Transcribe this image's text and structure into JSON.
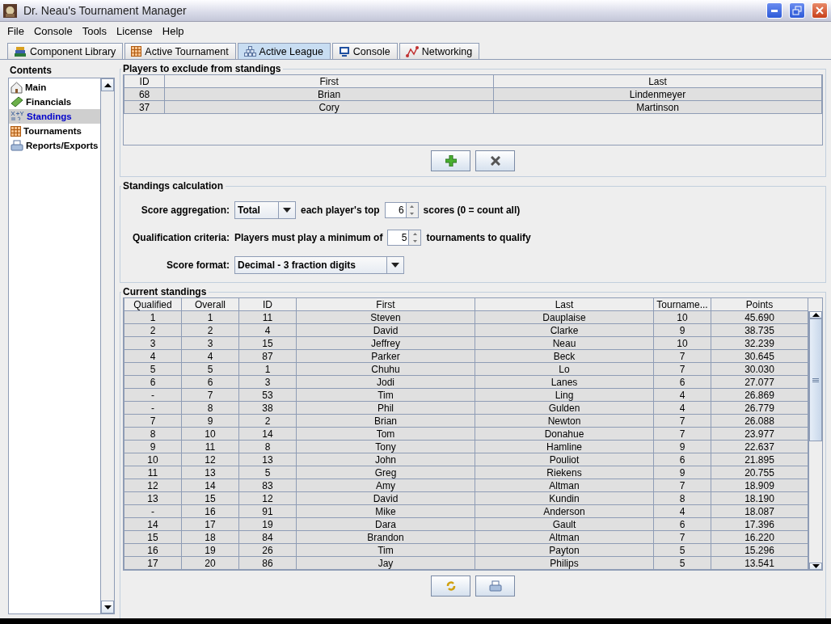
{
  "window": {
    "title": "Dr. Neau's Tournament Manager"
  },
  "menu": [
    "File",
    "Console",
    "Tools",
    "License",
    "Help"
  ],
  "tabs": [
    {
      "label": "Component Library",
      "selected": false
    },
    {
      "label": "Active Tournament",
      "selected": false
    },
    {
      "label": "Active League",
      "selected": true
    },
    {
      "label": "Console",
      "selected": false
    },
    {
      "label": "Networking",
      "selected": false
    }
  ],
  "sidebar": {
    "title": "Contents",
    "items": [
      {
        "label": "Main",
        "selected": false
      },
      {
        "label": "Financials",
        "selected": false
      },
      {
        "label": "Standings",
        "selected": true
      },
      {
        "label": "Tournaments",
        "selected": false
      },
      {
        "label": "Reports/Exports",
        "selected": false
      }
    ]
  },
  "excluded": {
    "title": "Players to exclude from standings",
    "columns": [
      "ID",
      "First",
      "Last"
    ],
    "rows": [
      [
        "68",
        "Brian",
        "Lindenmeyer"
      ],
      [
        "37",
        "Cory",
        "Martinson"
      ]
    ]
  },
  "calculation": {
    "title": "Standings calculation",
    "aggregation": {
      "label": "Score aggregation:",
      "value": "Total",
      "middle": "each player's top",
      "count": "6",
      "after": "scores (0 = count all)"
    },
    "qualification": {
      "label": "Qualification criteria:",
      "middle": "Players must play a minimum of",
      "count": "5",
      "after": "tournaments to qualify"
    },
    "format": {
      "label": "Score format:",
      "value": "Decimal - 3 fraction digits"
    }
  },
  "standings": {
    "title": "Current standings",
    "columns": [
      "Qualified",
      "Overall",
      "ID",
      "First",
      "Last",
      "Tourname...",
      "Points"
    ],
    "rows": [
      [
        "1",
        "1",
        "11",
        "Steven",
        "Dauplaise",
        "10",
        "45.690"
      ],
      [
        "2",
        "2",
        "4",
        "David",
        "Clarke",
        "9",
        "38.735"
      ],
      [
        "3",
        "3",
        "15",
        "Jeffrey",
        "Neau",
        "10",
        "32.239"
      ],
      [
        "4",
        "4",
        "87",
        "Parker",
        "Beck",
        "7",
        "30.645"
      ],
      [
        "5",
        "5",
        "1",
        "Chuhu",
        "Lo",
        "7",
        "30.030"
      ],
      [
        "6",
        "6",
        "3",
        "Jodi",
        "Lanes",
        "6",
        "27.077"
      ],
      [
        "-",
        "7",
        "53",
        "Tim",
        "Ling",
        "4",
        "26.869"
      ],
      [
        "-",
        "8",
        "38",
        "Phil",
        "Gulden",
        "4",
        "26.779"
      ],
      [
        "7",
        "9",
        "2",
        "Brian",
        "Newton",
        "7",
        "26.088"
      ],
      [
        "8",
        "10",
        "14",
        "Tom",
        "Donahue",
        "7",
        "23.977"
      ],
      [
        "9",
        "11",
        "8",
        "Tony",
        "Hamline",
        "9",
        "22.637"
      ],
      [
        "10",
        "12",
        "13",
        "John",
        "Pouliot",
        "6",
        "21.895"
      ],
      [
        "11",
        "13",
        "5",
        "Greg",
        "Riekens",
        "9",
        "20.755"
      ],
      [
        "12",
        "14",
        "83",
        "Amy",
        "Altman",
        "7",
        "18.909"
      ],
      [
        "13",
        "15",
        "12",
        "David",
        "Kundin",
        "8",
        "18.190"
      ],
      [
        "-",
        "16",
        "91",
        "Mike",
        "Anderson",
        "4",
        "18.087"
      ],
      [
        "14",
        "17",
        "19",
        "Dara",
        "Gault",
        "6",
        "17.396"
      ],
      [
        "15",
        "18",
        "84",
        "Brandon",
        "Altman",
        "7",
        "16.220"
      ],
      [
        "16",
        "19",
        "26",
        "Tim",
        "Payton",
        "5",
        "15.296"
      ],
      [
        "17",
        "20",
        "86",
        "Jay",
        "Philips",
        "5",
        "13.541"
      ]
    ]
  }
}
